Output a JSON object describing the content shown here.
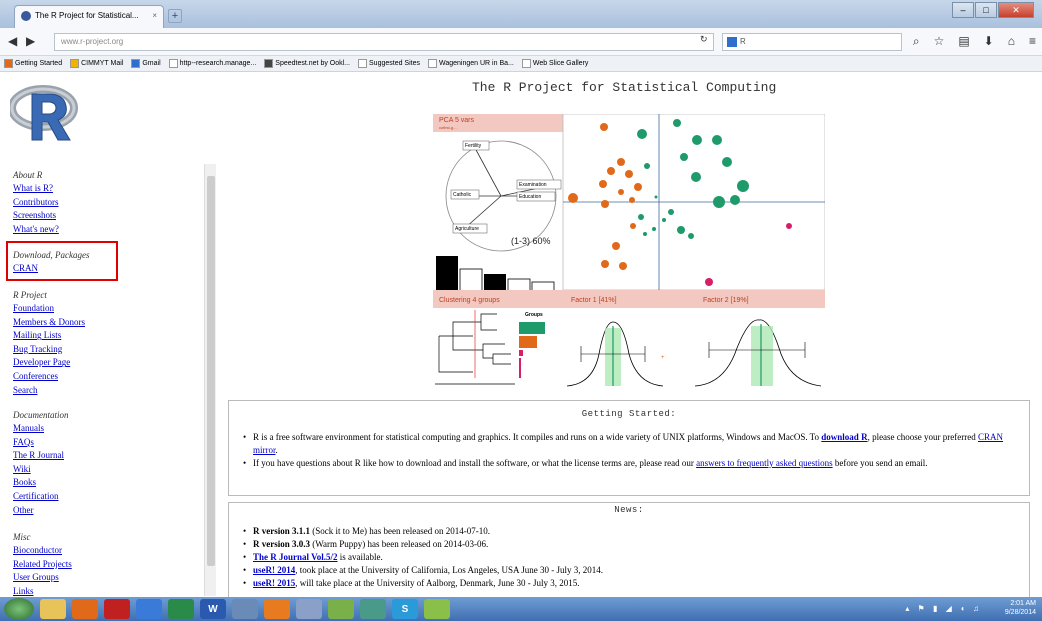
{
  "browser": {
    "tab_title": "The R Project for Statistical...",
    "tab_close": "×",
    "new_tab": "+",
    "url": "www.r-project.org",
    "search_text": "R",
    "bookmarks": [
      "Getting Started",
      "CIMMYT Mail",
      "Gmail",
      "http--research.manage...",
      "Speedtest.net by Ookl...",
      "Suggested Sites",
      "Wageningen UR in Ba...",
      "Web Slice Gallery"
    ]
  },
  "sidebar": {
    "about": {
      "heading": "About R",
      "links": [
        "What is R?",
        "Contributors",
        "Screenshots",
        "What's new?"
      ]
    },
    "download": {
      "heading": "Download, Packages",
      "links": [
        "CRAN"
      ]
    },
    "project": {
      "heading": "R Project",
      "links": [
        "Foundation",
        "Members & Donors",
        "Mailing Lists",
        "Bug Tracking",
        "Developer Page",
        "Conferences",
        "Search"
      ]
    },
    "documentation": {
      "heading": "Documentation",
      "links": [
        "Manuals",
        "FAQs",
        "The R Journal",
        "Wiki",
        "Books",
        "Certification",
        "Other"
      ]
    },
    "misc": {
      "heading": "Misc",
      "links": [
        "Bioconductor",
        "Related Projects",
        "User Groups",
        "Links"
      ]
    }
  },
  "page": {
    "title": "The R Project for Statistical Computing"
  },
  "figure": {
    "pca_label": "PCA 5 vars",
    "pca_sublabel": "cofirst-g...",
    "vars": [
      "Fertility",
      "Examination",
      "Education",
      "Catholic",
      "Agriculture"
    ],
    "variance": "(1-3) 60%",
    "clustering": "Clustering 4 groups",
    "factor1": "Factor 1 [41%]",
    "factor2": "Factor 2 [19%]",
    "groups": "Groups"
  },
  "getting_started": {
    "heading": "Getting Started:",
    "p1_a": "R is a free software environment for statistical computing and graphics. It compiles and runs on a wide variety of UNIX platforms, Windows and MacOS. To ",
    "p1_link1": "download R",
    "p1_b": ", please choose your preferred ",
    "p1_link2": "CRAN mirror",
    "p1_c": ".",
    "p2_a": "If you have questions about R like how to download and install the software, or what the license terms are, please read our ",
    "p2_link": "answers to frequently asked questions",
    "p2_b": " before you send an email."
  },
  "news": {
    "heading": "News:",
    "items": [
      {
        "bold": "R version 3.1.1",
        "text": " (Sock it to Me) has been released on 2014-07-10."
      },
      {
        "bold": "R version 3.0.3",
        "text": " (Warm Puppy) has been released on 2014-03-06."
      },
      {
        "link": "The R Journal Vol.5/2",
        "text": " is available."
      },
      {
        "link": "useR! 2014",
        "text": ", took place at the University of California, Los Angeles, USA June 30 - July 3, 2014."
      },
      {
        "link": "useR! 2015",
        "text": ", will take place at the University of Aalborg, Denmark, June 30 - July 3, 2015."
      }
    ]
  },
  "taskbar": {
    "time": "2:01 AM",
    "date": "9/28/2014",
    "apps": [
      "",
      "",
      "",
      "",
      "",
      "W",
      "",
      "",
      "",
      "",
      "",
      "S",
      ""
    ]
  }
}
